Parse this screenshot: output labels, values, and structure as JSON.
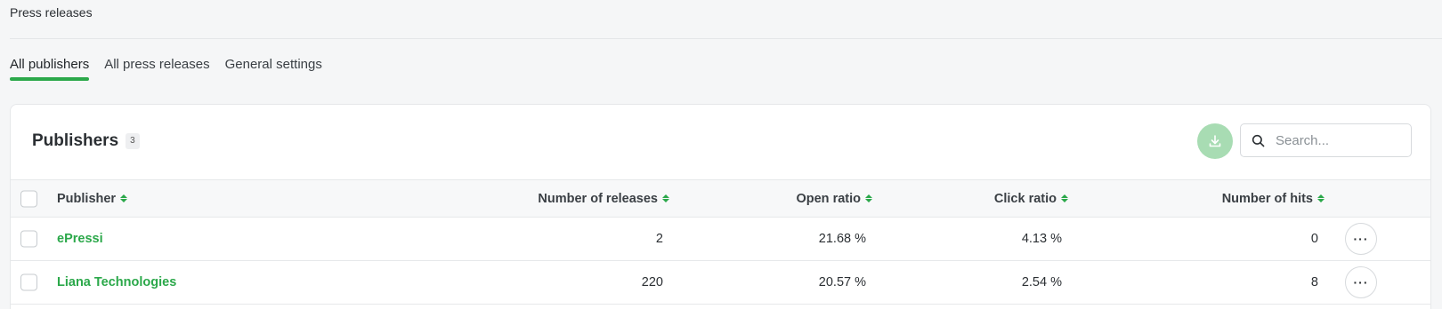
{
  "header": {
    "title": "Press releases"
  },
  "tabs": [
    {
      "label": "All publishers",
      "active": true
    },
    {
      "label": "All press releases",
      "active": false
    },
    {
      "label": "General settings",
      "active": false
    }
  ],
  "card": {
    "title": "Publishers",
    "count": "3",
    "search_placeholder": "Search...",
    "download_icon": "download-icon",
    "search_icon": "search-icon"
  },
  "table": {
    "columns": [
      "Publisher",
      "Number of releases",
      "Open ratio",
      "Click ratio",
      "Number of hits"
    ],
    "rows": [
      {
        "publisher": "ePressi",
        "releases": "2",
        "open_ratio": "21.68 %",
        "click_ratio": "4.13 %",
        "hits": "0",
        "more": "···"
      },
      {
        "publisher": "Liana Technologies",
        "releases": "220",
        "open_ratio": "20.57 %",
        "click_ratio": "2.54 %",
        "hits": "8",
        "more": "···"
      }
    ]
  },
  "colors": {
    "accent": "#2ba84a",
    "download_bg": "#a8dcb3"
  }
}
